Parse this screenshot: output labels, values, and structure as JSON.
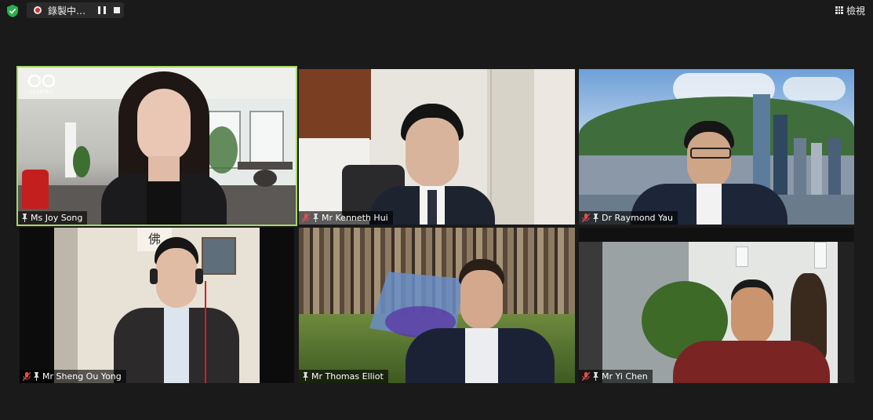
{
  "topbar": {
    "recording_label": "錄製中…",
    "view_label": "檢視",
    "shield_icon": "shield-check-icon",
    "pause_icon": "pause-icon",
    "stop_icon": "stop-icon",
    "grid_icon": "grid-view-icon"
  },
  "colors": {
    "background": "#1a1a1a",
    "active_speaker_border": "#a6d86a",
    "recording_red": "#e02828",
    "mute_red": "#e05050"
  },
  "participants": [
    {
      "name": "Ms Joy Song",
      "muted": false,
      "active_speaker": true,
      "logo_text": "CECEPEC"
    },
    {
      "name": "Mr Kenneth Hui",
      "muted": true,
      "active_speaker": false
    },
    {
      "name": "Dr Raymond Yau",
      "muted": true,
      "active_speaker": false
    },
    {
      "name": "Mr Sheng Ou Yong",
      "muted": true,
      "active_speaker": false,
      "wall_sign": "佛"
    },
    {
      "name": "Mr Thomas Elliot",
      "muted": false,
      "active_speaker": false
    },
    {
      "name": "Mr Yi Chen",
      "muted": true,
      "active_speaker": false
    }
  ]
}
